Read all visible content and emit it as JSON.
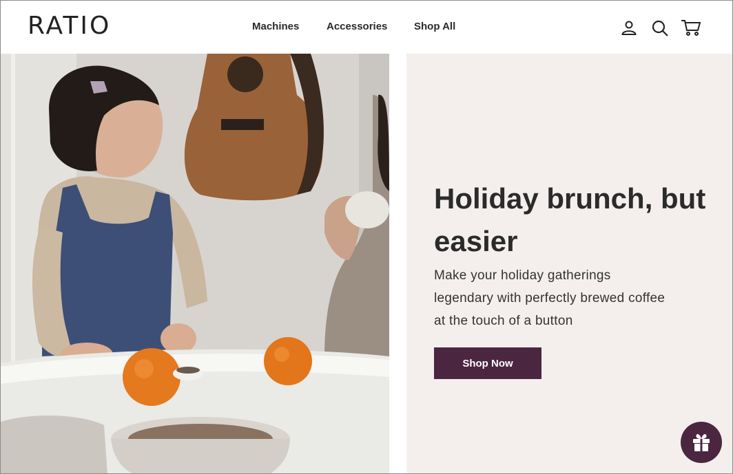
{
  "brand": {
    "logo_text": "RATIO"
  },
  "nav": {
    "items": [
      {
        "label": "Machines"
      },
      {
        "label": "Accessories"
      },
      {
        "label": "Shop All"
      }
    ]
  },
  "header_icons": [
    "account-icon",
    "search-icon",
    "cart-icon"
  ],
  "hero": {
    "headline": "Holiday brunch, but easier",
    "subtext": "Make your holiday gatherings legendary with perfectly brewed coffee at the touch of a button",
    "cta_label": "Shop Now"
  },
  "floating": {
    "icon": "gift-icon"
  },
  "colors": {
    "accent": "#4b2640",
    "panel_bg": "#f4efed",
    "text_dark": "#2b2b2b"
  }
}
